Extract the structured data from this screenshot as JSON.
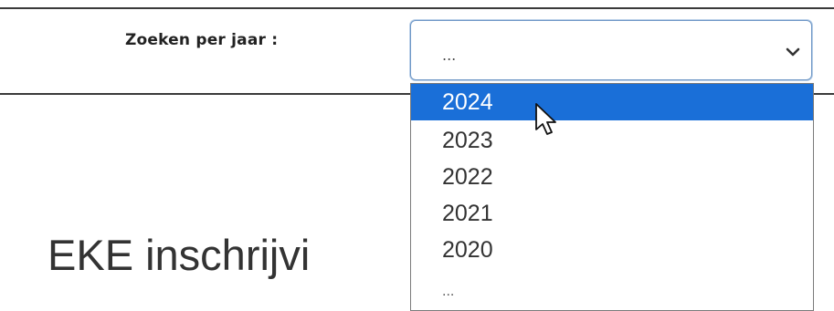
{
  "search": {
    "label": "Zoeken per jaar :",
    "selected_value": "..."
  },
  "dropdown": {
    "options": [
      "2024",
      "2023",
      "2022",
      "2021",
      "2020",
      "..."
    ],
    "highlighted": "2024"
  },
  "heading": {
    "text": "EKE inschrijvi"
  },
  "colors": {
    "highlight": "#1a6fd8",
    "select_border": "#6e97c6"
  }
}
